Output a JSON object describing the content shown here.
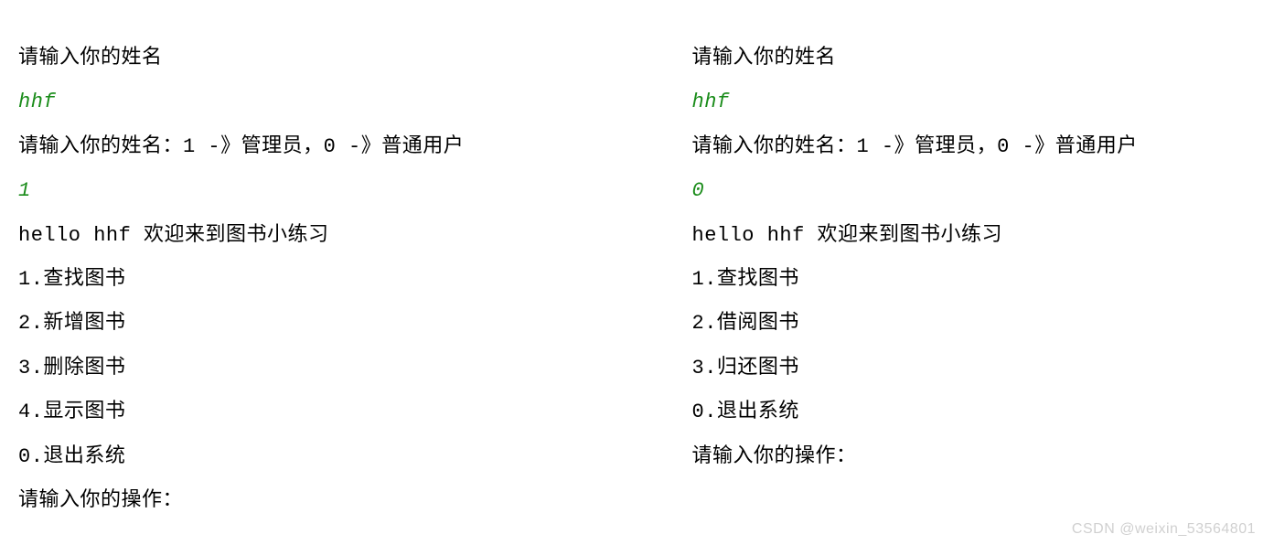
{
  "left_panel": {
    "prompt_name": "请输入你的姓名",
    "input_name": "hhf",
    "prompt_role": "请输入你的姓名：1 -》管理员，0 -》普通用户",
    "input_role": "1",
    "welcome": "hello hhf 欢迎来到图书小练习",
    "menu": [
      "1.查找图书",
      "2.新增图书",
      "3.删除图书",
      "4.显示图书",
      "0.退出系统"
    ],
    "prompt_action": "请输入你的操作："
  },
  "right_panel": {
    "prompt_name": "请输入你的姓名",
    "input_name": "hhf",
    "prompt_role": "请输入你的姓名：1 -》管理员，0 -》普通用户",
    "input_role": "0",
    "welcome": "hello hhf 欢迎来到图书小练习",
    "menu": [
      "1.查找图书",
      "2.借阅图书",
      "3.归还图书",
      "0.退出系统"
    ],
    "prompt_action": "请输入你的操作："
  },
  "watermark": "CSDN @weixin_53564801"
}
